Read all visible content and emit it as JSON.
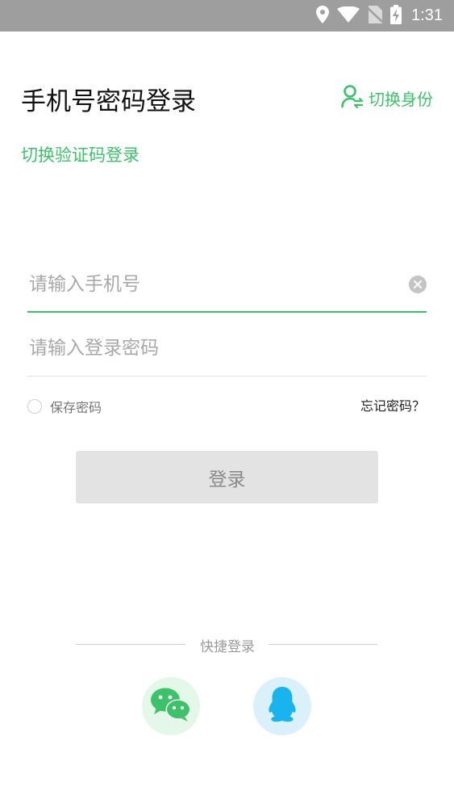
{
  "status_bar": {
    "time": "1:31",
    "icons": [
      "location-icon",
      "wifi-icon",
      "no-sim-icon",
      "battery-charging-icon"
    ]
  },
  "header": {
    "title": "手机号密码登录",
    "switch_identity_label": "切换身份",
    "switch_identity_icon": "user-switch-icon"
  },
  "switch_code_login_label": "切换验证码登录",
  "form": {
    "phone": {
      "value": "",
      "placeholder": "请输入手机号"
    },
    "password": {
      "value": "",
      "placeholder": "请输入登录密码"
    },
    "save_password_label": "保存密码",
    "save_password_checked": false,
    "forgot_password_label": "忘记密码？",
    "login_button_label": "登录"
  },
  "quick_login": {
    "label": "快捷登录",
    "providers": [
      "wechat-icon",
      "qq-icon"
    ]
  },
  "colors": {
    "accent": "#3cc36a",
    "status_bar": "#9e9e9e",
    "button_disabled": "#e3e3e3",
    "wechat": "#3cc36a",
    "qq": "#19b4ee"
  }
}
